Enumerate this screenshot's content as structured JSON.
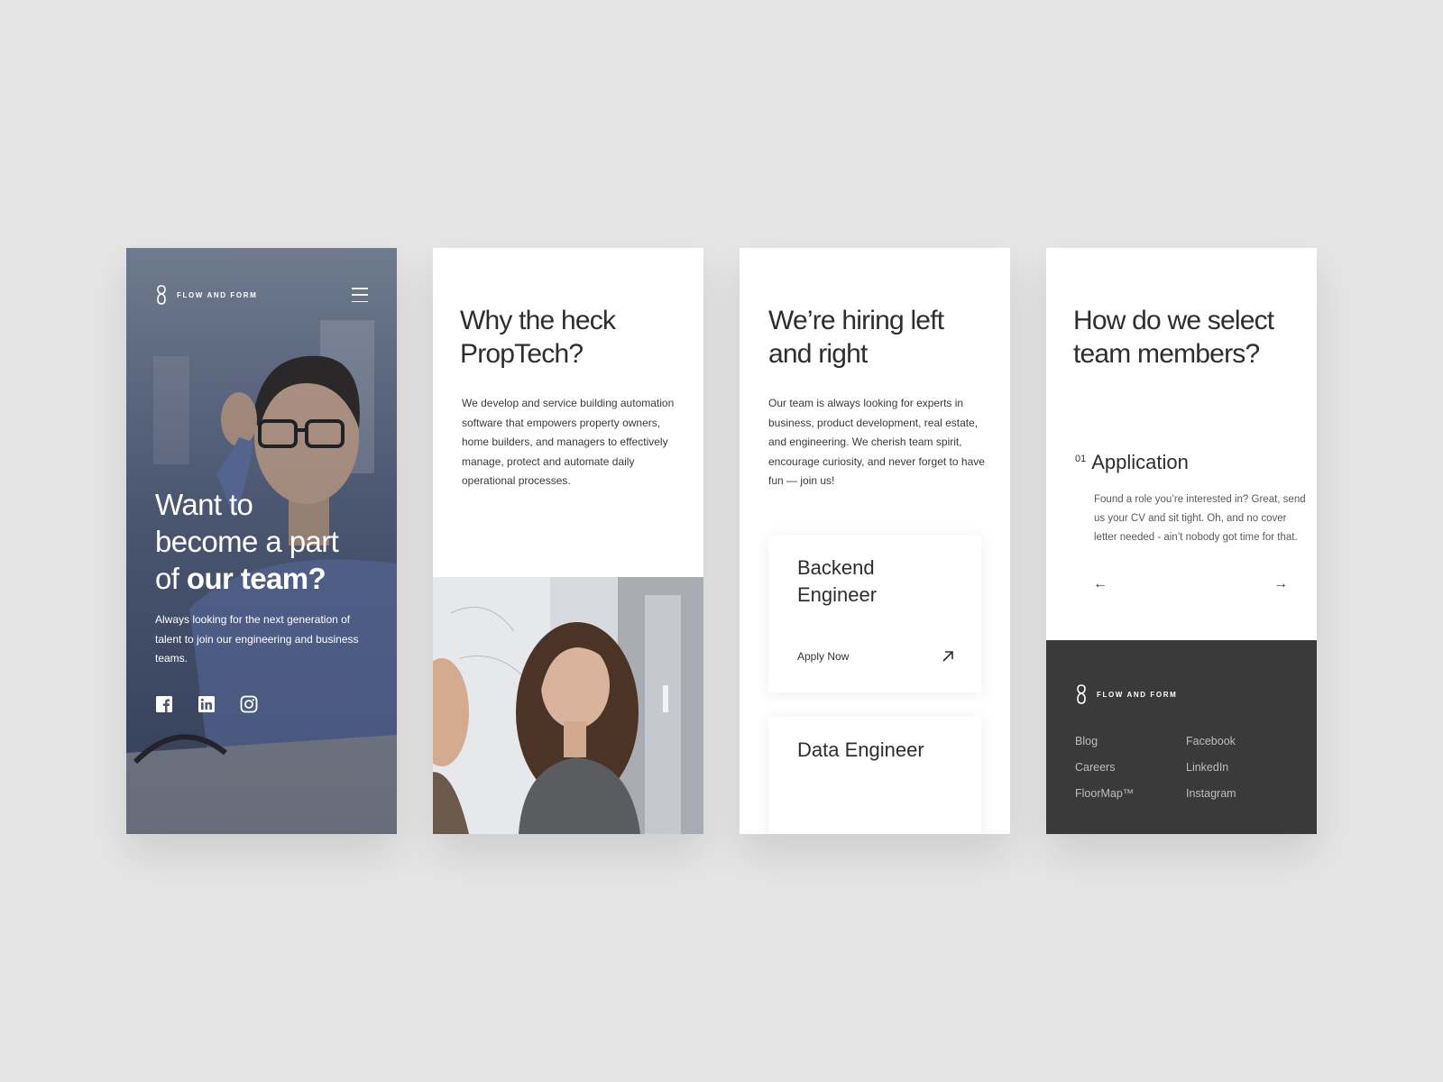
{
  "brand": {
    "name": "FLOW AND FORM"
  },
  "colors": {
    "background": "#e5e5e5",
    "text_dark": "#2f2f2f",
    "footer_bg": "#3a3a3a",
    "hero_overlay": "#4b5a78"
  },
  "screen1": {
    "menu_icon": "hamburger-icon",
    "title_line1": "Want to",
    "title_line2": "become a part",
    "title_line3_prefix": "of ",
    "title_line3_bold": "our team?",
    "subtitle": "Always looking for the next generation of talent to join our engineering and business teams.",
    "socials": [
      "facebook-icon",
      "linkedin-icon",
      "instagram-icon"
    ]
  },
  "screen2": {
    "title": "Why the heck PropTech?",
    "body": "We develop and service building automation software that empowers property owners, home builders, and managers to effectively manage, protect and automate daily operational processes."
  },
  "screen3": {
    "title": "We’re hiring left and right",
    "body": "Our team is always looking for experts in business, product development, real estate, and engineering. We cherish team spirit, encourage curiosity, and never forget to have fun — join  us!",
    "jobs": [
      {
        "title": "Backend Engineer",
        "cta": "Apply Now"
      },
      {
        "title": "Data Engineer"
      }
    ]
  },
  "screen4": {
    "title": "How do we select team members?",
    "step_number": "01",
    "step_title": "Application",
    "step_body": "Found a role you’re interested in? Great, send us your CV and sit tight. Oh, and no cover letter needed - ain’t nobody got time for that.",
    "prev_arrow": "←",
    "next_arrow": "→",
    "footer_links": [
      "Blog",
      "Facebook",
      "Careers",
      "LinkedIn",
      "FloorMap™",
      "Instagram"
    ]
  }
}
